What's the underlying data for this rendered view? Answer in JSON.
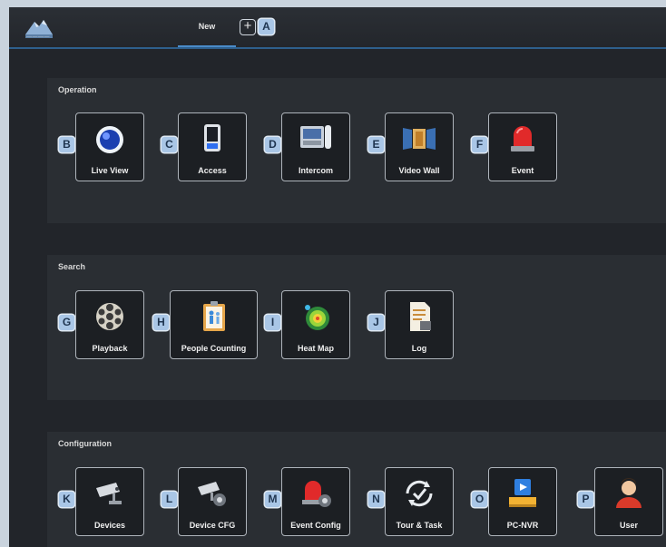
{
  "header": {
    "logo_text": "————",
    "active_tab": "New",
    "add_tab_symbol": "+",
    "add_tab_marker": "A"
  },
  "sections": [
    {
      "title": "Operation",
      "tiles": [
        {
          "marker": "B",
          "label": "Live View",
          "icon": "live-view-icon"
        },
        {
          "marker": "C",
          "label": "Access",
          "icon": "access-icon"
        },
        {
          "marker": "D",
          "label": "Intercom",
          "icon": "intercom-icon"
        },
        {
          "marker": "E",
          "label": "Video Wall",
          "icon": "video-wall-icon"
        },
        {
          "marker": "F",
          "label": "Event",
          "icon": "event-icon"
        }
      ]
    },
    {
      "title": "Search",
      "tiles": [
        {
          "marker": "G",
          "label": "Playback",
          "icon": "playback-icon"
        },
        {
          "marker": "H",
          "label": "People Counting",
          "icon": "people-counting-icon"
        },
        {
          "marker": "I",
          "label": "Heat Map",
          "icon": "heat-map-icon"
        },
        {
          "marker": "J",
          "label": "Log",
          "icon": "log-icon"
        }
      ]
    },
    {
      "title": "Configuration",
      "tiles": [
        {
          "marker": "K",
          "label": "Devices",
          "icon": "devices-icon"
        },
        {
          "marker": "L",
          "label": "Device CFG",
          "icon": "device-cfg-icon"
        },
        {
          "marker": "M",
          "label": "Event Config",
          "icon": "event-config-icon"
        },
        {
          "marker": "N",
          "label": "Tour & Task",
          "icon": "tour-task-icon"
        },
        {
          "marker": "O",
          "label": "PC-NVR",
          "icon": "pc-nvr-icon"
        },
        {
          "marker": "P",
          "label": "User",
          "icon": "user-icon"
        }
      ]
    }
  ],
  "colors": {
    "background": "#22252a",
    "section": "#2a2e33",
    "accent": "#4a8bc8",
    "marker": "#a9c6e6"
  }
}
